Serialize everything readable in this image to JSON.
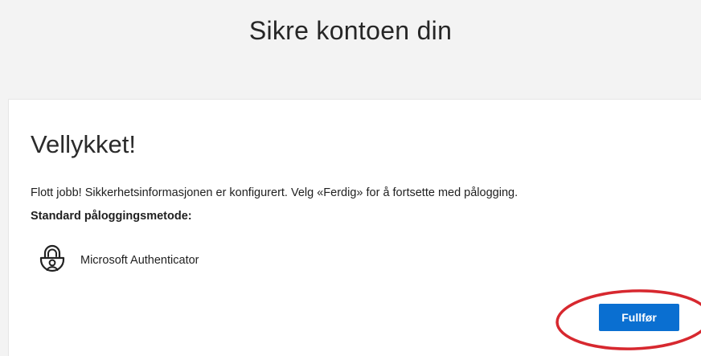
{
  "header": {
    "title": "Sikre kontoen din"
  },
  "card": {
    "heading": "Vellykket!",
    "message": "Flott jobb! Sikkerhetsinformasjonen er konfigurert. Velg «Ferdig» for å fortsette med pålogging.",
    "default_method_label": "Standard påloggingsmetode:",
    "method": {
      "name": "Microsoft Authenticator",
      "icon": "authenticator-lock-icon"
    },
    "finish_button_label": "Fullfør"
  },
  "colors": {
    "page_background": "#f3f3f3",
    "card_background": "#ffffff",
    "button_primary": "#0a6fd1",
    "annotation": "#d7282f"
  }
}
